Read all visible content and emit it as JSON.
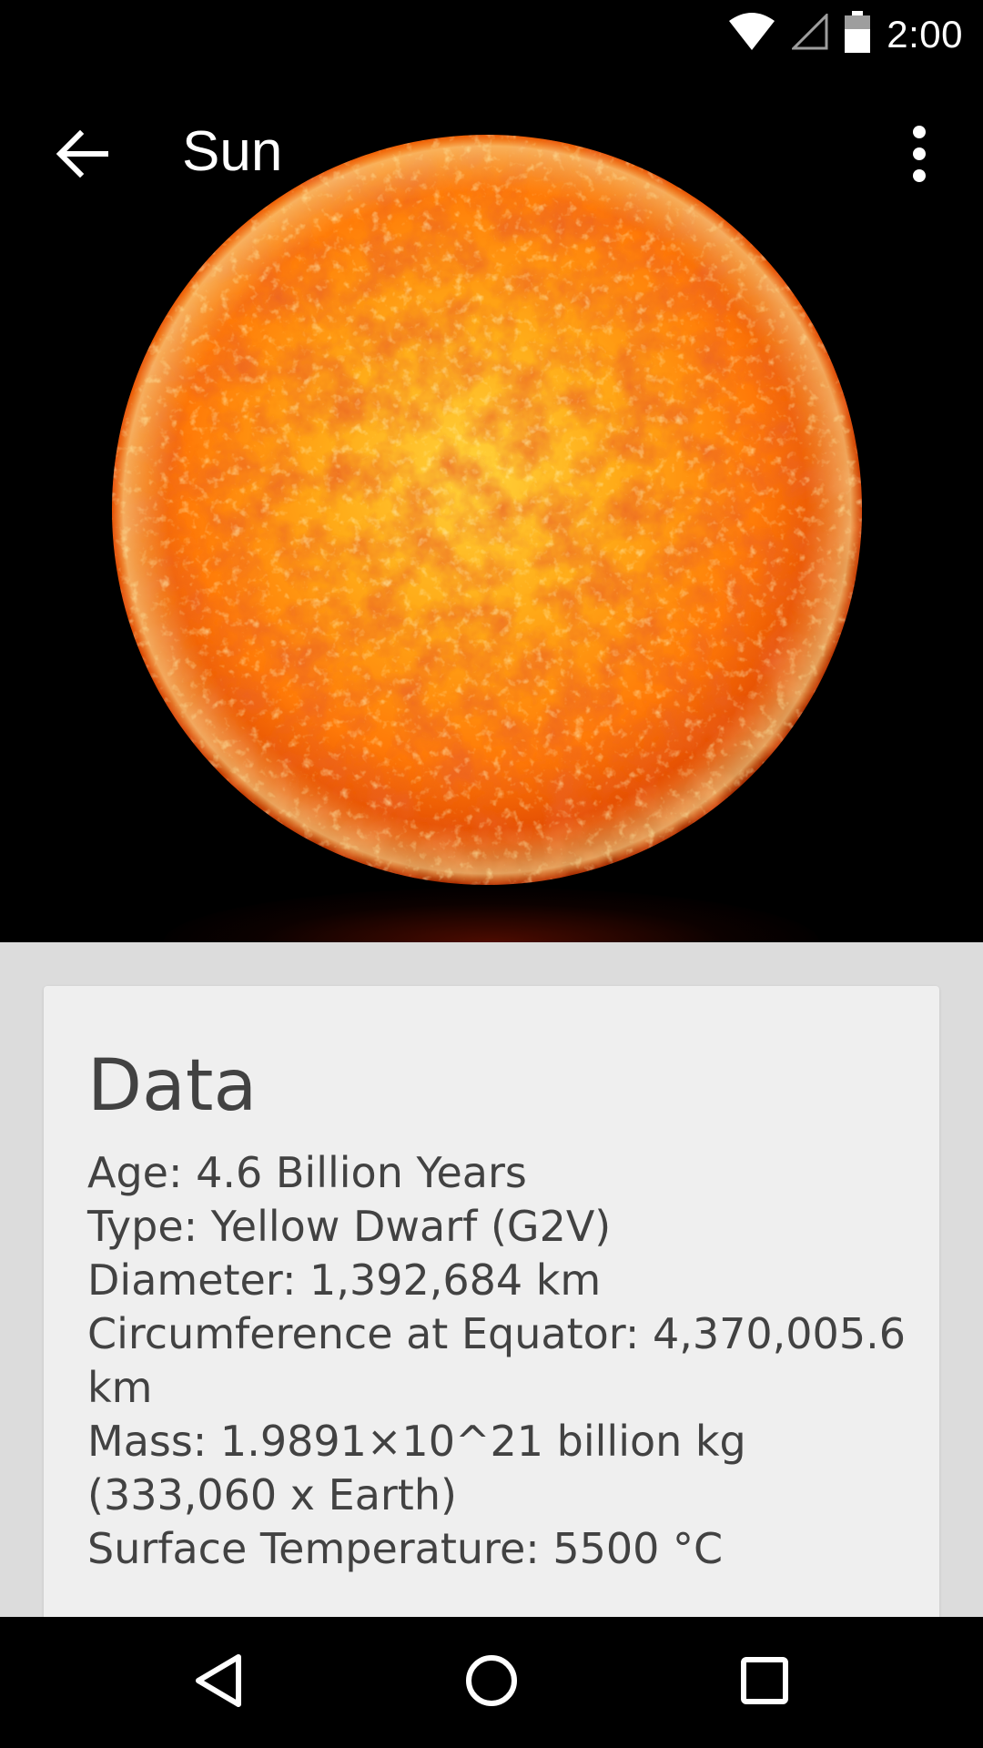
{
  "status_bar": {
    "time": "2:00",
    "icons": [
      "wifi-icon",
      "cellular-signal-icon",
      "battery-icon"
    ]
  },
  "toolbar": {
    "title": "Sun",
    "back_icon": "arrow-back-icon",
    "overflow_icon": "more-vertical-icon"
  },
  "hero": {
    "image": "sun-image"
  },
  "card": {
    "title": "Data",
    "lines": [
      "Age: 4.6 Billion Years",
      "Type: Yellow Dwarf (G2V)",
      "Diameter: 1,392,684 km",
      "Circumference at Equator: 4,370,005.6 km",
      "Mass: 1.9891×10^21 billion kg (333,060 x Earth)",
      "Surface Temperature: 5500 °C"
    ]
  },
  "nav_bar": {
    "icons": [
      "back-triangle-icon",
      "home-circle-icon",
      "recents-square-icon"
    ]
  },
  "colors": {
    "background": "#dcdcdc",
    "card": "#efefef",
    "text": "#424242",
    "sun_core": "#ffc21a",
    "sun_mid": "#ff8a00",
    "sun_edge": "#c43400"
  }
}
